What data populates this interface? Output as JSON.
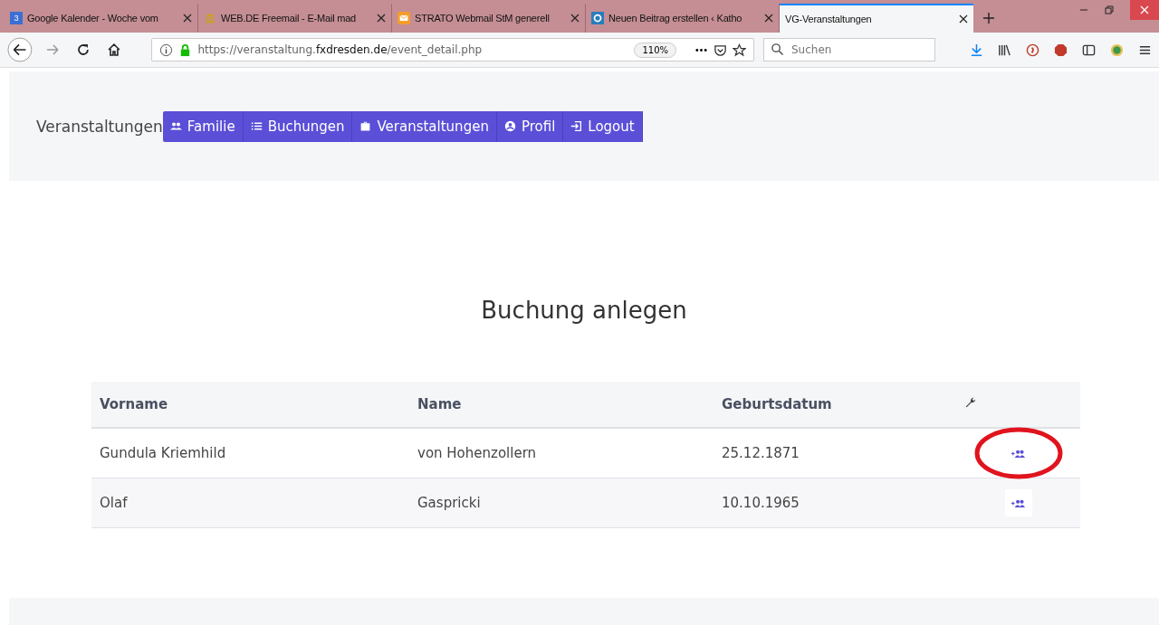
{
  "browser": {
    "tabs": [
      {
        "title": "Google Kalender - Woche vom",
        "selected": false
      },
      {
        "title": "WEB.DE Freemail - E-Mail mad",
        "selected": false
      },
      {
        "title": "STRATO Webmail StM generell",
        "selected": false
      },
      {
        "title": "Neuen Beitrag erstellen ‹ Katho",
        "selected": false
      },
      {
        "title": "VG-Veranstaltungen",
        "selected": true
      }
    ],
    "calendar_icon_text": "3",
    "url_prefix": "https://veranstaltung.",
    "url_domain": "fxdresden.de",
    "url_path": "/event_detail.php",
    "zoom": "110%",
    "search": {
      "placeholder": "Suchen"
    }
  },
  "brand": "Veranstaltungen",
  "nav": [
    {
      "label": "Familie"
    },
    {
      "label": "Buchungen"
    },
    {
      "label": "Veranstaltungen"
    },
    {
      "label": "Profil"
    },
    {
      "label": "Logout"
    }
  ],
  "heading": "Buchung anlegen",
  "table": {
    "columns": [
      "Vorname",
      "Name",
      "Geburtsdatum"
    ],
    "rows": [
      {
        "cells": [
          "Gundula Kriemhild",
          "von Hohenzollern",
          "25.12.1871"
        ],
        "highlighted": true
      },
      {
        "cells": [
          "Olaf",
          "Gaspricki",
          "10.10.1965"
        ],
        "highlighted": false
      }
    ]
  }
}
